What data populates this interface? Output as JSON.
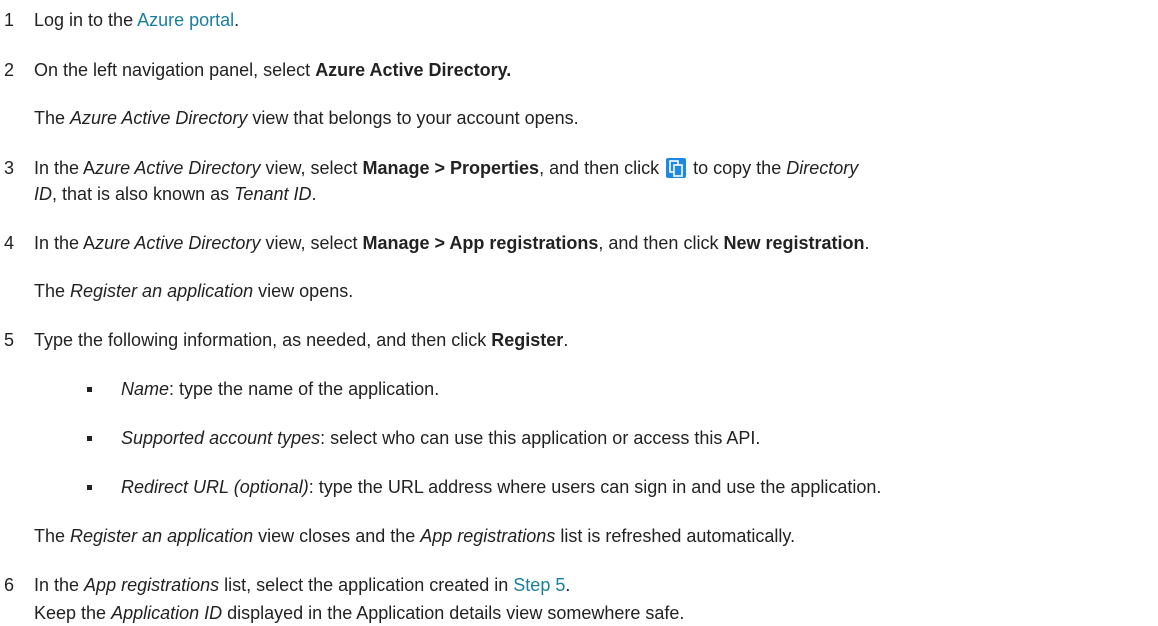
{
  "steps": [
    {
      "num": "1",
      "parts": [
        "Log in to the ",
        "Azure portal",
        "."
      ]
    },
    {
      "num": "2",
      "parts": [
        "On the left navigation panel, select ",
        "Azure Active Directory."
      ],
      "note": [
        "The ",
        "Azure Active Directory",
        " view that belongs to your account opens."
      ]
    },
    {
      "num": "3",
      "line1": [
        "In the A",
        "zure Active Directory",
        " view, select ",
        "Manage > Properties",
        ", and then click ",
        " to copy the ",
        "Directory"
      ],
      "line2": [
        "ID",
        ", that is also known as ",
        "Tenant ID",
        "."
      ]
    },
    {
      "num": "4",
      "parts": [
        "In the A",
        "zure Active Directory",
        " view, select ",
        "Manage > App registrations",
        ", and then click ",
        "New registration",
        "."
      ],
      "note": [
        "The ",
        "Register an application",
        " view opens."
      ]
    },
    {
      "num": "5",
      "parts": [
        "Type the following information, as needed, and then click ",
        "Register",
        "."
      ],
      "bullets": [
        {
          "term": "Name",
          "rest": ": type the name of the application."
        },
        {
          "term": "Supported account types",
          "rest": ": select who can use this application or access this API."
        },
        {
          "term": "Redirect URL (optional)",
          "rest": ": type the URL address where users can sign in and use the application."
        }
      ],
      "note": [
        "The ",
        "Register an application",
        " view closes and the ",
        "App registrations",
        " list is refreshed automatically."
      ]
    },
    {
      "num": "6",
      "parts": [
        "In the ",
        "App registrations",
        " list, select the application created in ",
        "Step 5",
        "."
      ],
      "note": [
        "Keep the ",
        "Application ID",
        " displayed in the Application details view somewhere safe."
      ]
    }
  ],
  "icons": {
    "copy": "copy-icon"
  },
  "colors": {
    "link": "#1a7f9f",
    "copy_icon": "#1e88e5"
  }
}
